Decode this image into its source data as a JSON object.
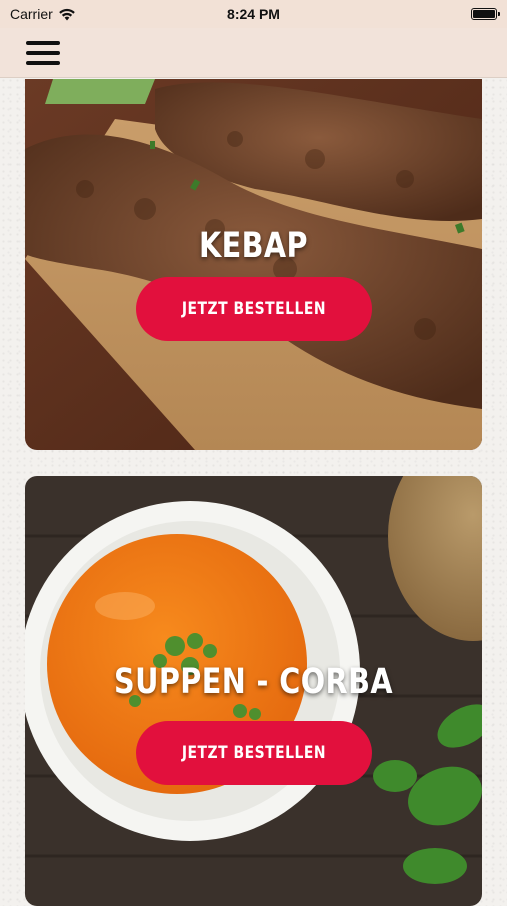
{
  "status_bar": {
    "carrier": "Carrier",
    "time": "8:24 PM"
  },
  "nav": {
    "menu_icon": "hamburger-menu-icon"
  },
  "categories": [
    {
      "title": "KEBAP",
      "button_label": "JETZT BESTELLEN"
    },
    {
      "title": "SUPPEN - CORBA",
      "button_label": "JETZT BESTELLEN"
    }
  ],
  "colors": {
    "accent": "#e2103d",
    "nav_bg": "#f2e3da"
  }
}
